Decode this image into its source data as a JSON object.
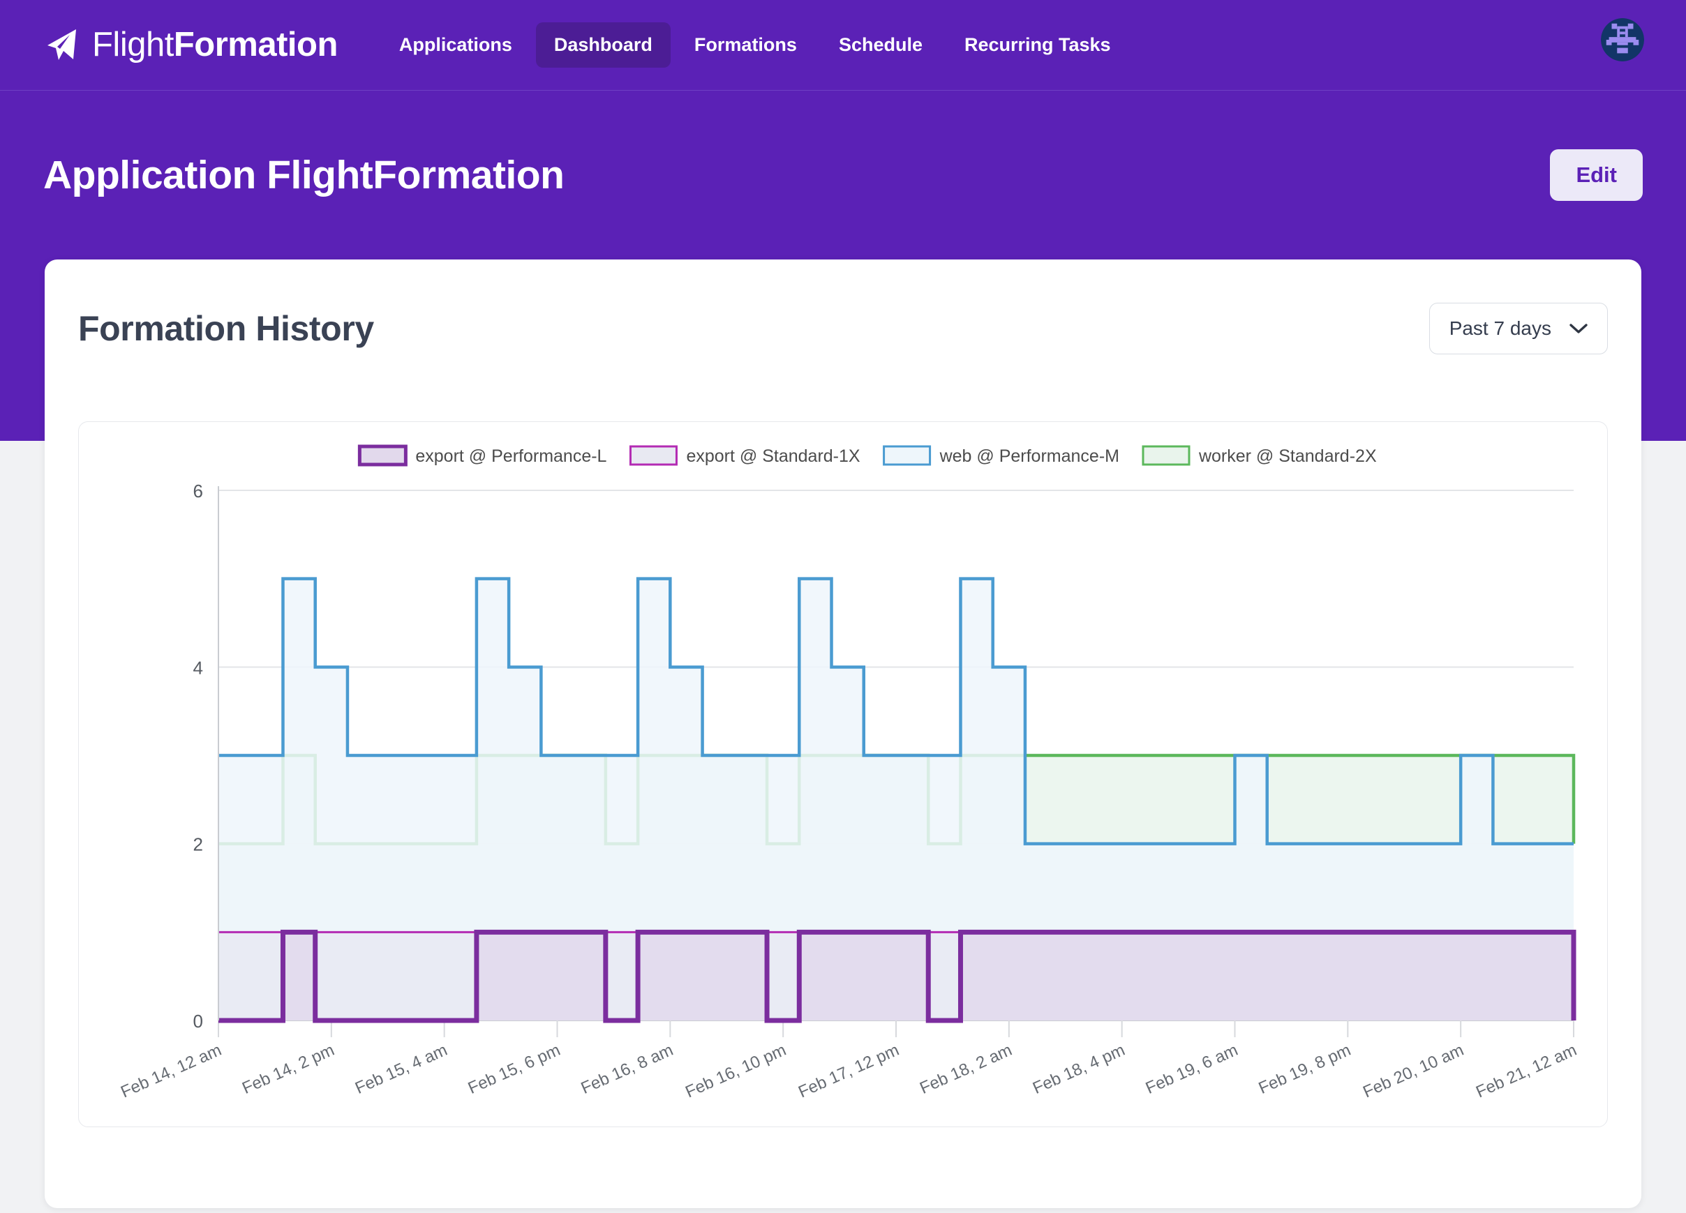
{
  "nav": {
    "brand": {
      "thin": "Flight",
      "bold": "Formation",
      "icon": "paper-plane-icon"
    },
    "items": [
      {
        "label": "Applications",
        "active": false
      },
      {
        "label": "Dashboard",
        "active": true
      },
      {
        "label": "Formations",
        "active": false
      },
      {
        "label": "Schedule",
        "active": false
      },
      {
        "label": "Recurring Tasks",
        "active": false
      }
    ],
    "avatar_icon": "user-identicon-avatar"
  },
  "header": {
    "title": "Application FlightFormation",
    "edit_label": "Edit"
  },
  "card": {
    "title": "Formation History",
    "range_value": "Past 7 days",
    "range_icon": "chevron-down-icon"
  },
  "colors": {
    "brand_purple": "#5b21b6",
    "nav_active": "#4c1d95",
    "edit_bg": "#ece9f8",
    "page_bg": "#f1f2f4",
    "heading": "#3a4254",
    "series_export_perf_l": "#7b2d9e",
    "series_export_std_1x": "#b32bb3",
    "series_web_perf_m": "#4a9bd1",
    "series_worker_std_2x": "#5cb85c"
  },
  "chart_data": {
    "type": "area",
    "title": "Formation History",
    "xlabel": "",
    "ylabel": "",
    "ylim": [
      0,
      6
    ],
    "yticks": [
      0,
      2,
      4,
      6
    ],
    "grid": true,
    "legend_position": "top",
    "step": "post",
    "x_tick_labels": [
      "Feb 14, 12 am",
      "Feb 14, 2 pm",
      "Feb 15, 4 am",
      "Feb 15, 6 pm",
      "Feb 16, 8 am",
      "Feb 16, 10 pm",
      "Feb 17, 12 pm",
      "Feb 18, 2 am",
      "Feb 18, 4 pm",
      "Feb 19, 6 am",
      "Feb 19, 8 pm",
      "Feb 20, 10 am",
      "Feb 21, 12 am"
    ],
    "x_domain": [
      0,
      168
    ],
    "x_tick_values": [
      0,
      14,
      28,
      42,
      56,
      70,
      84,
      98,
      112,
      126,
      140,
      154,
      168
    ],
    "series": [
      {
        "name": "export @ Performance-L",
        "color": "#7b2d9e",
        "fill": "#e2d9ec",
        "draw_order": 1,
        "x": [
          0,
          8,
          12,
          28,
          32,
          48,
          52,
          68,
          72,
          88,
          92,
          168
        ],
        "values": [
          0,
          1,
          0,
          0,
          1,
          0,
          1,
          0,
          1,
          0,
          1,
          0
        ]
      },
      {
        "name": "export @ Standard-1X",
        "color": "#b32bb3",
        "fill": "#e8e9f2",
        "draw_order": 2,
        "x": [
          0,
          168
        ],
        "values": [
          1,
          1
        ]
      },
      {
        "name": "web @ Performance-M",
        "color": "#4a9bd1",
        "fill": "#eef6fb",
        "draw_order": 3,
        "x": [
          0,
          8,
          12,
          16,
          28,
          32,
          36,
          40,
          48,
          52,
          56,
          60,
          68,
          72,
          76,
          80,
          88,
          92,
          96,
          100,
          112,
          126,
          130,
          140,
          154,
          158,
          168
        ],
        "values": [
          3,
          5,
          4,
          3,
          3,
          5,
          4,
          3,
          3,
          5,
          4,
          3,
          3,
          5,
          4,
          3,
          3,
          5,
          4,
          2,
          2,
          3,
          2,
          2,
          3,
          2,
          2
        ]
      },
      {
        "name": "worker @ Standard-2X",
        "color": "#5cb85c",
        "fill": "#e9f4ec",
        "draw_order": 4,
        "x": [
          0,
          8,
          12,
          28,
          32,
          48,
          52,
          68,
          72,
          88,
          92,
          168
        ],
        "values": [
          2,
          3,
          2,
          2,
          3,
          2,
          3,
          2,
          3,
          2,
          3,
          2
        ]
      }
    ]
  }
}
